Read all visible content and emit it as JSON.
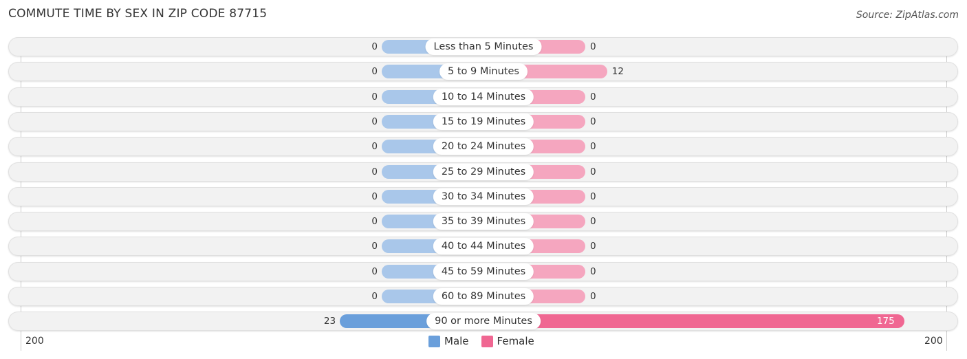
{
  "title": "COMMUTE TIME BY SEX IN ZIP CODE 87715",
  "source": "Source: ZipAtlas.com",
  "colors": {
    "male": "#6a9fdb",
    "male_light": "#a9c7ea",
    "female": "#f06792",
    "female_light": "#f5a6bf"
  },
  "chart_data": {
    "type": "bar",
    "orientation": "horizontal-diverging",
    "title": "COMMUTE TIME BY SEX IN ZIP CODE 87715",
    "categories": [
      "Less than 5 Minutes",
      "5 to 9 Minutes",
      "10 to 14 Minutes",
      "15 to 19 Minutes",
      "20 to 24 Minutes",
      "25 to 29 Minutes",
      "30 to 34 Minutes",
      "35 to 39 Minutes",
      "40 to 44 Minutes",
      "45 to 59 Minutes",
      "60 to 89 Minutes",
      "90 or more Minutes"
    ],
    "series": [
      {
        "name": "Male",
        "values": [
          0,
          0,
          0,
          0,
          0,
          0,
          0,
          0,
          0,
          0,
          0,
          23
        ]
      },
      {
        "name": "Female",
        "values": [
          0,
          12,
          0,
          0,
          0,
          0,
          0,
          0,
          0,
          0,
          0,
          175
        ]
      }
    ],
    "axis": {
      "left_label": "200",
      "right_label": "200",
      "max": 200
    },
    "legend": {
      "position": "bottom-center",
      "entries": [
        "Male",
        "Female"
      ]
    }
  }
}
